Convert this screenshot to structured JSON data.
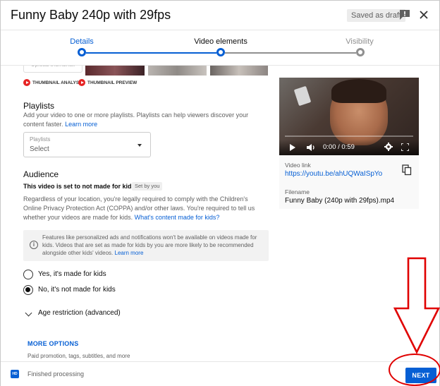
{
  "header": {
    "title": "Funny Baby 240p with 29fps",
    "draft_badge": "Saved as draft",
    "feedback_icon": "feedback-icon",
    "close_icon": "close-icon"
  },
  "stepper": {
    "steps": [
      {
        "label": "Details",
        "state": "active"
      },
      {
        "label": "Video elements",
        "state": "active"
      },
      {
        "label": "Visibility",
        "state": "inactive"
      }
    ]
  },
  "thumbnails": {
    "upload_label": "Upload thumbnail",
    "chips": [
      "THUMBNAIL ANALYSIS",
      "THUMBNAIL PREVIEW"
    ]
  },
  "playlists": {
    "title": "Playlists",
    "description": "Add your video to one or more playlists. Playlists can help viewers discover your content faster.",
    "learn_more": "Learn more",
    "select_label": "Playlists",
    "select_value": "Select"
  },
  "audience": {
    "title": "Audience",
    "status": "This video is set to not made for kids",
    "set_by": "Set by you",
    "description": "Regardless of your location, you're legally required to comply with the Children's Online Privacy Protection Act (COPPA) and/or other laws. You're required to tell us whether your videos are made for kids.",
    "description_link": "What's content made for kids?",
    "info_text": "Features like personalized ads and notifications won't be available on videos made for kids. Videos that are set as made for kids by you are more likely to be recommended alongside other kids' videos.",
    "info_link": "Learn more",
    "options": [
      {
        "label": "Yes, it's made for kids",
        "selected": false
      },
      {
        "label": "No, it's not made for kids",
        "selected": true
      }
    ],
    "age_restriction": "Age restriction (advanced)"
  },
  "more_options": {
    "label": "MORE OPTIONS",
    "sub": "Paid promotion, tags, subtitles, and more"
  },
  "preview": {
    "time": "0:00 / 0:59",
    "video_link_label": "Video link",
    "video_link": "https://youtu.be/ahUQWaISpYo",
    "filename_label": "Filename",
    "filename": "Funny Baby (240p with 29fps).mp4"
  },
  "footer": {
    "status": "Finished processing",
    "hd_badge": "HD",
    "next": "NEXT"
  },
  "colors": {
    "accent": "#065fd4",
    "annotation": "#e00000"
  }
}
